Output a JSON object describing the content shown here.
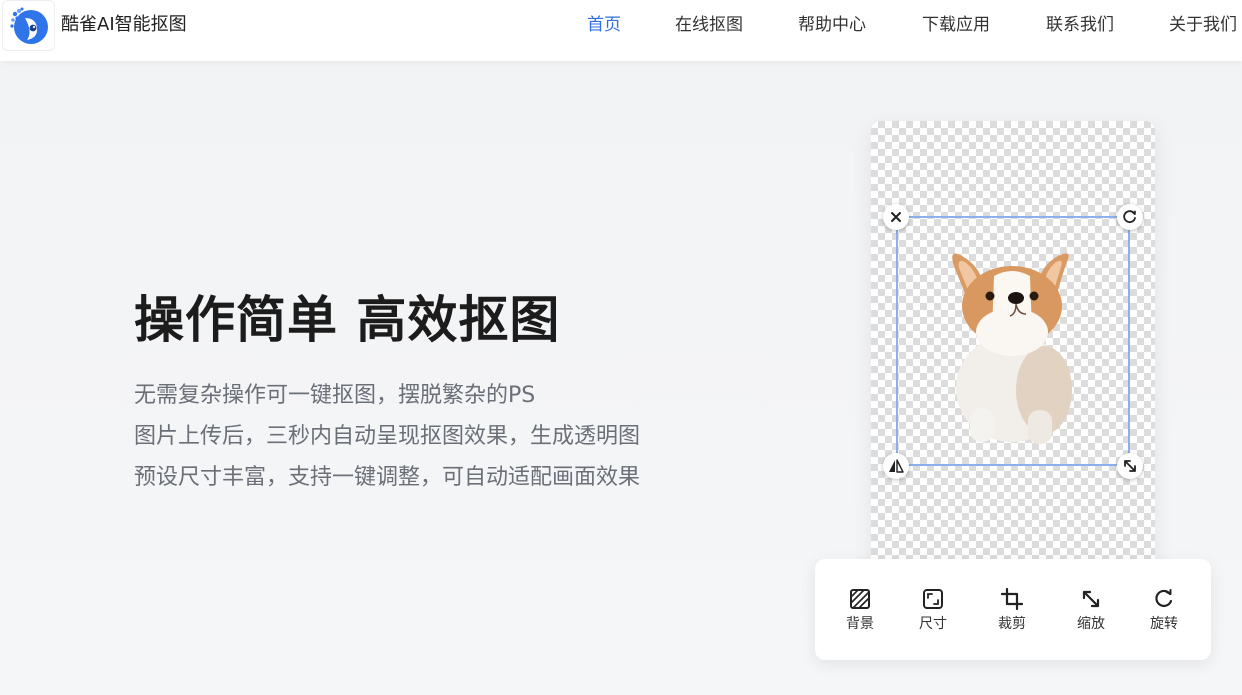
{
  "header": {
    "app_name": "酷雀AI智能抠图",
    "nav": [
      {
        "label": "首页",
        "active": true
      },
      {
        "label": "在线抠图"
      },
      {
        "label": "帮助中心"
      },
      {
        "label": "下载应用"
      },
      {
        "label": "联系我们"
      },
      {
        "label": "关于我们"
      }
    ]
  },
  "hero": {
    "headline": "操作简单 高效抠图",
    "lines": [
      "无需复杂操作可一键抠图，摆脱繁杂的PS",
      "图片上传后，三秒内自动呈现抠图效果，生成透明图",
      "预设尺寸丰富，支持一键调整，可自动适配画面效果"
    ]
  },
  "editor": {
    "handles": [
      "close-icon",
      "rotate-icon",
      "flip-icon",
      "resize-icon"
    ]
  },
  "toolbar": {
    "tools": [
      {
        "label": "背景",
        "icon": "background-icon"
      },
      {
        "label": "尺寸",
        "icon": "size-icon"
      },
      {
        "label": "裁剪",
        "icon": "crop-icon"
      },
      {
        "label": "缩放",
        "icon": "zoom-icon"
      },
      {
        "label": "旋转",
        "icon": "rotate-icon"
      }
    ]
  },
  "colors": {
    "accent": "#2f6fe0",
    "selection": "#8db0ec"
  }
}
